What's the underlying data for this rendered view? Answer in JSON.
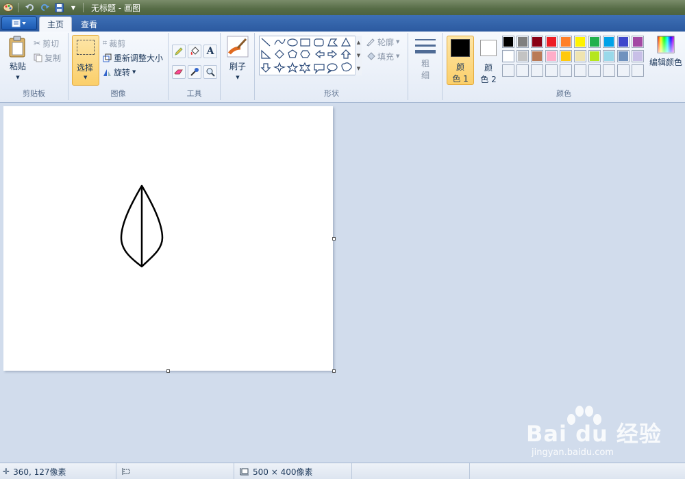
{
  "titlebar": {
    "title": "无标题 - 画图",
    "quick_access": [
      "app-icon",
      "undo-icon",
      "redo-icon",
      "save-icon",
      "dropdown-icon"
    ]
  },
  "tabs": {
    "home": "主页",
    "view": "查看"
  },
  "clipboard": {
    "paste": "粘贴",
    "cut": "剪切",
    "copy": "复制",
    "label": "剪贴板"
  },
  "image": {
    "select": "选择",
    "crop": "裁剪",
    "resize": "重新调整大小",
    "rotate": "旋转",
    "label": "图像"
  },
  "tools": {
    "label": "工具",
    "items": [
      "pencil-icon",
      "fill-icon",
      "text-icon",
      "eraser-icon",
      "color-picker-icon",
      "magnifier-icon"
    ]
  },
  "brushes": {
    "label": "刷子"
  },
  "shapes": {
    "label": "形状",
    "outline": "轮廓",
    "fill": "填充"
  },
  "size": {
    "label_line1": "粗",
    "label_line2": "细"
  },
  "colors": {
    "color1_line1": "颜",
    "color1_line2": "色 1",
    "color2_line1": "颜",
    "color2_line2": "色 2",
    "color1_value": "#000000",
    "color2_value": "#ffffff",
    "edit": "编辑颜色",
    "label": "颜色",
    "palette_row1": [
      "#000000",
      "#7f7f7f",
      "#880015",
      "#ed1c24",
      "#ff7f27",
      "#fff200",
      "#22b14c",
      "#00a2e8",
      "#3f48cc",
      "#a349a4"
    ],
    "palette_row2": [
      "#ffffff",
      "#c3c3c3",
      "#b97a57",
      "#ffaec9",
      "#ffc90e",
      "#efe4b0",
      "#b5e61d",
      "#99d9ea",
      "#7092be",
      "#c8bfe7"
    ]
  },
  "status": {
    "cursor_position": "360, 127像素",
    "canvas_size": "500 × 400像素"
  },
  "watermark": {
    "brand": "Bai du 经验",
    "url": "jingyan.baidu.com"
  },
  "accent": {
    "selected_button": "#fbcf6a",
    "ribbon_bg": "#e4ebf6",
    "workspace_bg": "#d1dcec"
  }
}
